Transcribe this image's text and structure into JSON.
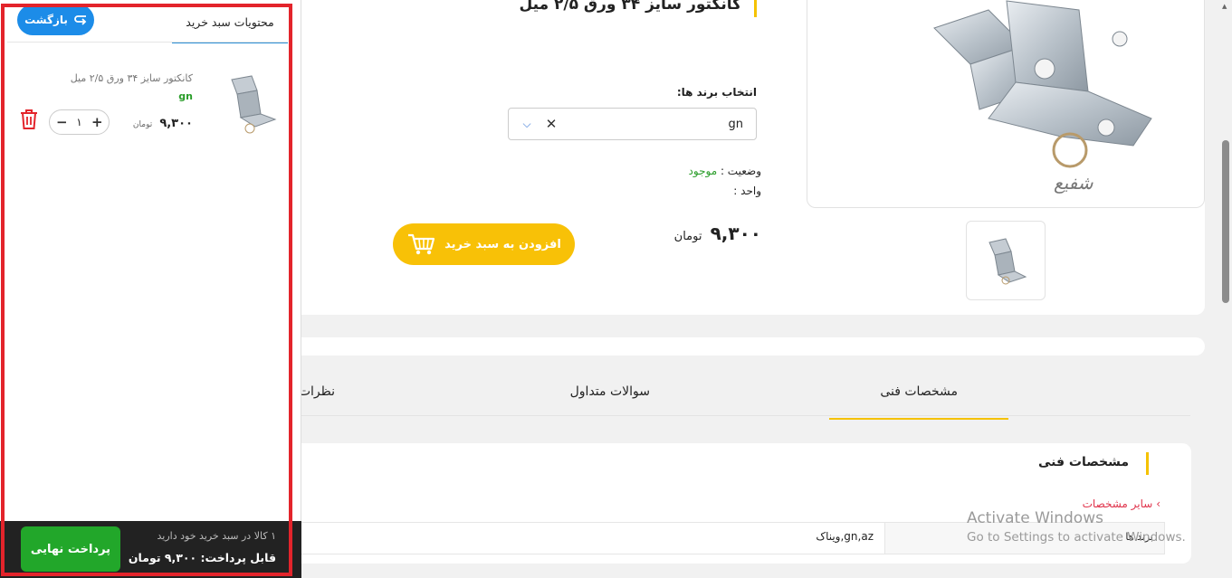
{
  "product": {
    "title": "کانکتور سایز ۳۴ ورق ۲/۵ میل",
    "brand_label": "انتخاب برند ها:",
    "brand_selected": "gn",
    "status_label": "وضعیت :",
    "status_value": "موجود",
    "unit_label": "واحد :",
    "price": "۹,۳۰۰",
    "currency": "تومان",
    "add_to_cart": "افزودن به سبد خرید",
    "watermark": "شفیع"
  },
  "tabs": [
    {
      "label": "مشخصات فنی",
      "active": true
    },
    {
      "label": "سوالات متداول",
      "active": false
    },
    {
      "label": "نظرات",
      "active": false
    }
  ],
  "specs": {
    "title": "مشخصات فنی",
    "other_specs": "سایر مشخصات",
    "row_key": "برند ها",
    "row_value": "gn,az,ویناک"
  },
  "cart": {
    "title": "محتویات سبد خرید",
    "back_button": "بازگشت",
    "item": {
      "name": "کانکتور سایز ۳۴ ورق ۲/۵ میل",
      "brand": "gn",
      "price": "۹,۳۰۰",
      "currency": "تومان",
      "quantity": "۱"
    },
    "footer": {
      "count_text": "۱ کالا در سبد خرید خود دارید",
      "total_text": "قابل پرداخت: ۹,۳۰۰ تومان",
      "checkout_button": "پرداخت نهایی"
    }
  },
  "os_overlay": {
    "line1": "Activate Windows",
    "line2": "Go to Settings to activate Windows."
  },
  "colors": {
    "accent_yellow": "#f8c107",
    "outline_red": "#e3242b",
    "back_blue": "#1c8ce8",
    "checkout_green": "#22a72a",
    "status_green": "#2a9d2a"
  }
}
